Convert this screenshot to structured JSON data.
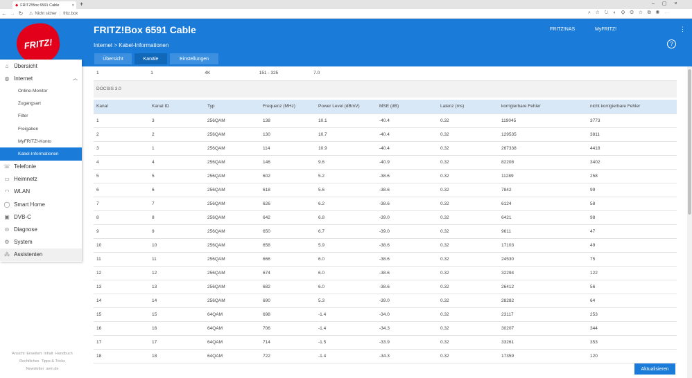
{
  "browser": {
    "tab_title": "FRITZ!Box 6591 Cable",
    "security": "Nicht sicher",
    "url": "fritz.box"
  },
  "header": {
    "logo": "FRITZ!",
    "title": "FRITZ!Box 6591 Cable",
    "links": [
      "FRITZ!NAS",
      "MyFRITZ!"
    ],
    "breadcrumb": "Internet > Kabel-Informationen",
    "tabs": [
      "Übersicht",
      "Kanäle",
      "Einstellungen"
    ],
    "help": "?"
  },
  "sidebar": {
    "items": [
      {
        "label": "Übersicht",
        "icon": "home-icon"
      },
      {
        "label": "Internet",
        "icon": "globe-icon",
        "expanded": true,
        "sub": [
          "Online-Monitor",
          "Zugangsart",
          "Filter",
          "Freigaben",
          "MyFRITZ!-Konto",
          "Kabel-Informationen"
        ],
        "active": "Kabel-Informationen"
      },
      {
        "label": "Telefonie",
        "icon": "phone-icon"
      },
      {
        "label": "Heimnetz",
        "icon": "network-icon"
      },
      {
        "label": "WLAN",
        "icon": "wifi-icon"
      },
      {
        "label": "Smart Home",
        "icon": "smarthome-icon"
      },
      {
        "label": "DVB-C",
        "icon": "tv-icon"
      },
      {
        "label": "Diagnose",
        "icon": "diagnose-icon"
      },
      {
        "label": "System",
        "icon": "gear-icon"
      },
      {
        "label": "Assistenten",
        "icon": "wizard-icon"
      }
    ]
  },
  "footer": {
    "links1": [
      "Ansicht: Erweitert",
      "Inhalt",
      "Handbuch"
    ],
    "links2": [
      "Rechtliches",
      "Tipps & Tricks"
    ],
    "links3": [
      "Newsletter",
      "avm.de"
    ]
  },
  "ofdm_row": [
    "1",
    "1",
    "4K",
    "151 - 325",
    "7.0"
  ],
  "section_title": "DOCSIS 3.0",
  "columns": [
    "Kanal",
    "Kanal ID",
    "Typ",
    "Frequenz (MHz)",
    "Power Level (dBmV)",
    "MSE (dB)",
    "Latenz (ms)",
    "korrigierbare Fehler",
    "nicht korrigierbare Fehler"
  ],
  "rows": [
    [
      "1",
      "3",
      "256QAM",
      "138",
      "10.1",
      "-40.4",
      "0.32",
      "119045",
      "3773"
    ],
    [
      "2",
      "2",
      "256QAM",
      "130",
      "10.7",
      "-40.4",
      "0.32",
      "129535",
      "3811"
    ],
    [
      "3",
      "1",
      "256QAM",
      "114",
      "10.9",
      "-40.4",
      "0.32",
      "267338",
      "4418"
    ],
    [
      "4",
      "4",
      "256QAM",
      "146",
      "9.6",
      "-40.9",
      "0.32",
      "82208",
      "3402"
    ],
    [
      "5",
      "5",
      "256QAM",
      "602",
      "5.2",
      "-38.6",
      "0.32",
      "11289",
      "258"
    ],
    [
      "6",
      "6",
      "256QAM",
      "618",
      "5.6",
      "-38.6",
      "0.32",
      "7842",
      "99"
    ],
    [
      "7",
      "7",
      "256QAM",
      "626",
      "6.2",
      "-38.6",
      "0.32",
      "6124",
      "58"
    ],
    [
      "8",
      "8",
      "256QAM",
      "642",
      "6.8",
      "-39.0",
      "0.32",
      "6421",
      "98"
    ],
    [
      "9",
      "9",
      "256QAM",
      "650",
      "6.7",
      "-39.0",
      "0.32",
      "9611",
      "47"
    ],
    [
      "10",
      "10",
      "256QAM",
      "658",
      "5.9",
      "-38.6",
      "0.32",
      "17103",
      "49"
    ],
    [
      "11",
      "11",
      "256QAM",
      "666",
      "6.0",
      "-38.6",
      "0.32",
      "24530",
      "75"
    ],
    [
      "12",
      "12",
      "256QAM",
      "674",
      "6.0",
      "-38.6",
      "0.32",
      "32294",
      "122"
    ],
    [
      "13",
      "13",
      "256QAM",
      "682",
      "6.0",
      "-38.6",
      "0.32",
      "26412",
      "56"
    ],
    [
      "14",
      "14",
      "256QAM",
      "690",
      "5.3",
      "-39.0",
      "0.32",
      "28282",
      "64"
    ],
    [
      "15",
      "15",
      "64QAM",
      "698",
      "-1.4",
      "-34.0",
      "0.32",
      "23117",
      "253"
    ],
    [
      "16",
      "16",
      "64QAM",
      "706",
      "-1.4",
      "-34.3",
      "0.32",
      "30207",
      "344"
    ],
    [
      "17",
      "17",
      "64QAM",
      "714",
      "-1.5",
      "-33.9",
      "0.32",
      "33261",
      "353"
    ],
    [
      "18",
      "18",
      "64QAM",
      "722",
      "-1.4",
      "-34.3",
      "0.32",
      "17359",
      "120"
    ]
  ],
  "button": "Aktualisieren"
}
